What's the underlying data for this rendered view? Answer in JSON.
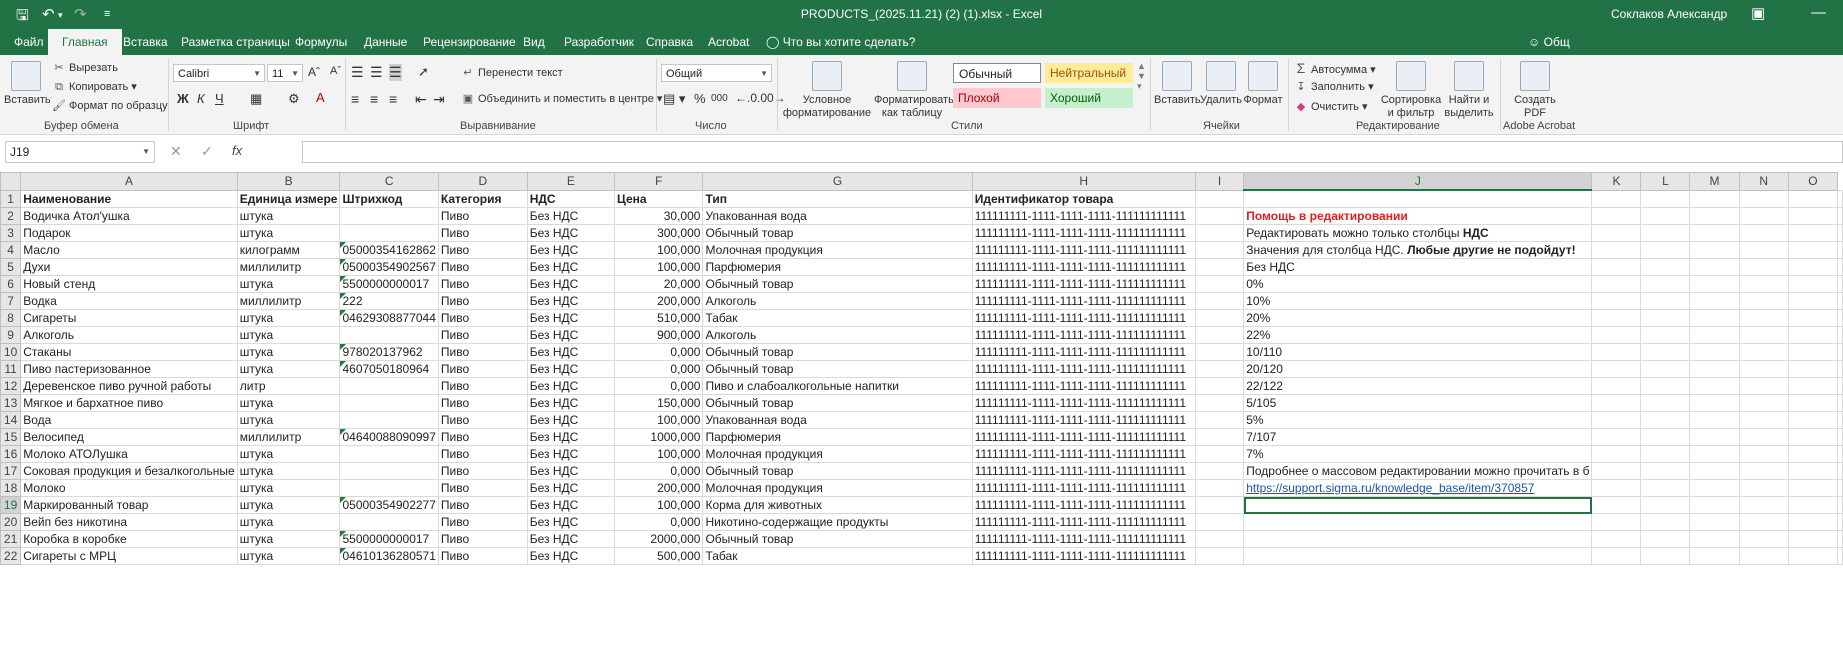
{
  "window": {
    "title": "PRODUCTS_(2025.11.21) (2) (1).xlsx  -  Excel",
    "user": "Соклаков Александр"
  },
  "tabs": [
    "Файл",
    "Главная",
    "Вставка",
    "Разметка страницы",
    "Формулы",
    "Данные",
    "Рецензирование",
    "Вид",
    "Разработчик",
    "Справка",
    "Acrobat",
    "Что вы хотите сделать?",
    "Общ"
  ],
  "ribbon": {
    "clipboard": {
      "paste": "Вставить",
      "cut": "Вырезать",
      "copy": "Копировать",
      "format_painter": "Формат по образцу",
      "label": "Буфер обмена"
    },
    "font": {
      "name": "Calibri",
      "size": "11",
      "label": "Шрифт",
      "bold": "Ж",
      "italic": "К",
      "underline": "Ч"
    },
    "alignment": {
      "wrap": "Перенести текст",
      "merge": "Объединить и поместить в центре",
      "label": "Выравнивание"
    },
    "number": {
      "format": "Общий",
      "percent": "%",
      "thousands": "000",
      "label": "Число"
    },
    "styles": {
      "conditional": "Условное форматирование",
      "as_table": "Форматировать как таблицу",
      "normal": "Обычный",
      "neutral": "Нейтральный",
      "bad": "Плохой",
      "good": "Хороший",
      "label": "Стили"
    },
    "cells": {
      "insert": "Вставить",
      "delete": "Удалить",
      "format": "Формат",
      "label": "Ячейки"
    },
    "editing": {
      "autosum": "Автосумма",
      "fill": "Заполнить",
      "clear": "Очистить",
      "sort": "Сортировка и фильтр",
      "find": "Найти и выделить",
      "label": "Редактирование"
    },
    "acrobat": {
      "create": "Создать PDF",
      "label": "Adobe Acrobat"
    }
  },
  "formula_bar": {
    "name_box": "J19",
    "fx": "fx",
    "value": ""
  },
  "columns": [
    "A",
    "B",
    "C",
    "D",
    "E",
    "F",
    "G",
    "H",
    "I",
    "J",
    "K",
    "L",
    "M",
    "N",
    "O"
  ],
  "header_row": [
    "Наименование",
    "Единица измере",
    "Штрихкод",
    "Категория",
    "НДС",
    "Цена",
    "Тип",
    "Идентификатор товара"
  ],
  "rows": [
    [
      "Водичка Атол'ушка",
      "штука",
      "",
      "Пиво",
      "Без НДС",
      "30,000",
      "Упакованная вода",
      "111111111-1111-1111-1111-111111111111"
    ],
    [
      "Подарок",
      "штука",
      "",
      "Пиво",
      "Без НДС",
      "300,000",
      "Обычный товар",
      "111111111-1111-1111-1111-111111111111"
    ],
    [
      "Масло",
      "килограмм",
      "05000354162862",
      "Пиво",
      "Без НДС",
      "100,000",
      "Молочная продукция",
      "111111111-1111-1111-1111-111111111111"
    ],
    [
      "Духи",
      "миллилитр",
      "05000354902567",
      "Пиво",
      "Без НДС",
      "100,000",
      "Парфюмерия",
      "111111111-1111-1111-1111-111111111111"
    ],
    [
      "Новый стенд",
      "штука",
      "5500000000017",
      "Пиво",
      "Без НДС",
      "20,000",
      "Обычный товар",
      "111111111-1111-1111-1111-111111111111"
    ],
    [
      "Водка",
      "миллилитр",
      "222",
      "Пиво",
      "Без НДС",
      "200,000",
      "Алкоголь",
      "111111111-1111-1111-1111-111111111111"
    ],
    [
      "Сигареты",
      "штука",
      "04629308877044",
      "Пиво",
      "Без НДС",
      "510,000",
      "Табак",
      "111111111-1111-1111-1111-111111111111"
    ],
    [
      "Алкоголь",
      "штука",
      "",
      "Пиво",
      "Без НДС",
      "900,000",
      "Алкоголь",
      "111111111-1111-1111-1111-111111111111"
    ],
    [
      "Стаканы",
      "штука",
      "978020137962",
      "Пиво",
      "Без НДС",
      "0,000",
      "Обычный товар",
      "111111111-1111-1111-1111-111111111111"
    ],
    [
      "Пиво пастеризованное",
      "штука",
      "4607050180964",
      "Пиво",
      "Без НДС",
      "0,000",
      "Обычный товар",
      "111111111-1111-1111-1111-111111111111"
    ],
    [
      "Деревенское пиво ручной работы",
      "литр",
      "",
      "Пиво",
      "Без НДС",
      "0,000",
      "Пиво и слабоалкогольные напитки",
      "111111111-1111-1111-1111-111111111111"
    ],
    [
      "Мягкое и бархатное пиво",
      "штука",
      "",
      "Пиво",
      "Без НДС",
      "150,000",
      "Обычный товар",
      "111111111-1111-1111-1111-111111111111"
    ],
    [
      "Вода",
      "штука",
      "",
      "Пиво",
      "Без НДС",
      "100,000",
      "Упакованная вода",
      "111111111-1111-1111-1111-111111111111"
    ],
    [
      "Велосипед",
      "миллилитр",
      "04640088090997",
      "Пиво",
      "Без НДС",
      "1000,000",
      "Парфюмерия",
      "111111111-1111-1111-1111-111111111111"
    ],
    [
      "Молоко АТОЛушка",
      "штука",
      "",
      "Пиво",
      "Без НДС",
      "100,000",
      "Молочная продукция",
      "111111111-1111-1111-1111-111111111111"
    ],
    [
      "Соковая продукция и безалкогольные",
      "штука",
      "",
      "Пиво",
      "Без НДС",
      "0,000",
      "Обычный товар",
      "111111111-1111-1111-1111-111111111111"
    ],
    [
      "Молоко",
      "штука",
      "",
      "Пиво",
      "Без НДС",
      "200,000",
      "Молочная продукция",
      "111111111-1111-1111-1111-111111111111"
    ],
    [
      "Маркированный товар",
      "штука",
      "05000354902277",
      "Пиво",
      "Без НДС",
      "100,000",
      "Корма для животных",
      "111111111-1111-1111-1111-111111111111"
    ],
    [
      "Вейп без никотина",
      "штука",
      "",
      "Пиво",
      "Без НДС",
      "0,000",
      "Никотино-содержащие продукты",
      "111111111-1111-1111-1111-111111111111"
    ],
    [
      "Коробка в коробке",
      "штука",
      "5500000000017",
      "Пиво",
      "Без НДС",
      "2000,000",
      "Обычный товар",
      "111111111-1111-1111-1111-111111111111"
    ],
    [
      "Сигареты с МРЦ",
      "штука",
      "04610136280571",
      "Пиво",
      "Без НДС",
      "500,000",
      "Табак",
      "111111111-1111-1111-1111-111111111111"
    ]
  ],
  "help": {
    "title": "Помощь в редактировании",
    "line1_a": "Редактировать можно только столбцы ",
    "line1_b": "НДС",
    "line2_a": "Значения для столбца НДС. ",
    "line2_b": "Любые другие не подойдут!",
    "values": [
      "Без НДС",
      "0%",
      "10%",
      "20%",
      "22%",
      "10/110",
      "20/120",
      "22/122",
      "5/105",
      "5%",
      "7/107",
      "7%"
    ],
    "more": "Подробнее о массовом редактировании можно прочитать в б",
    "link": "https://support.sigma.ru/knowledge_base/item/370857"
  }
}
